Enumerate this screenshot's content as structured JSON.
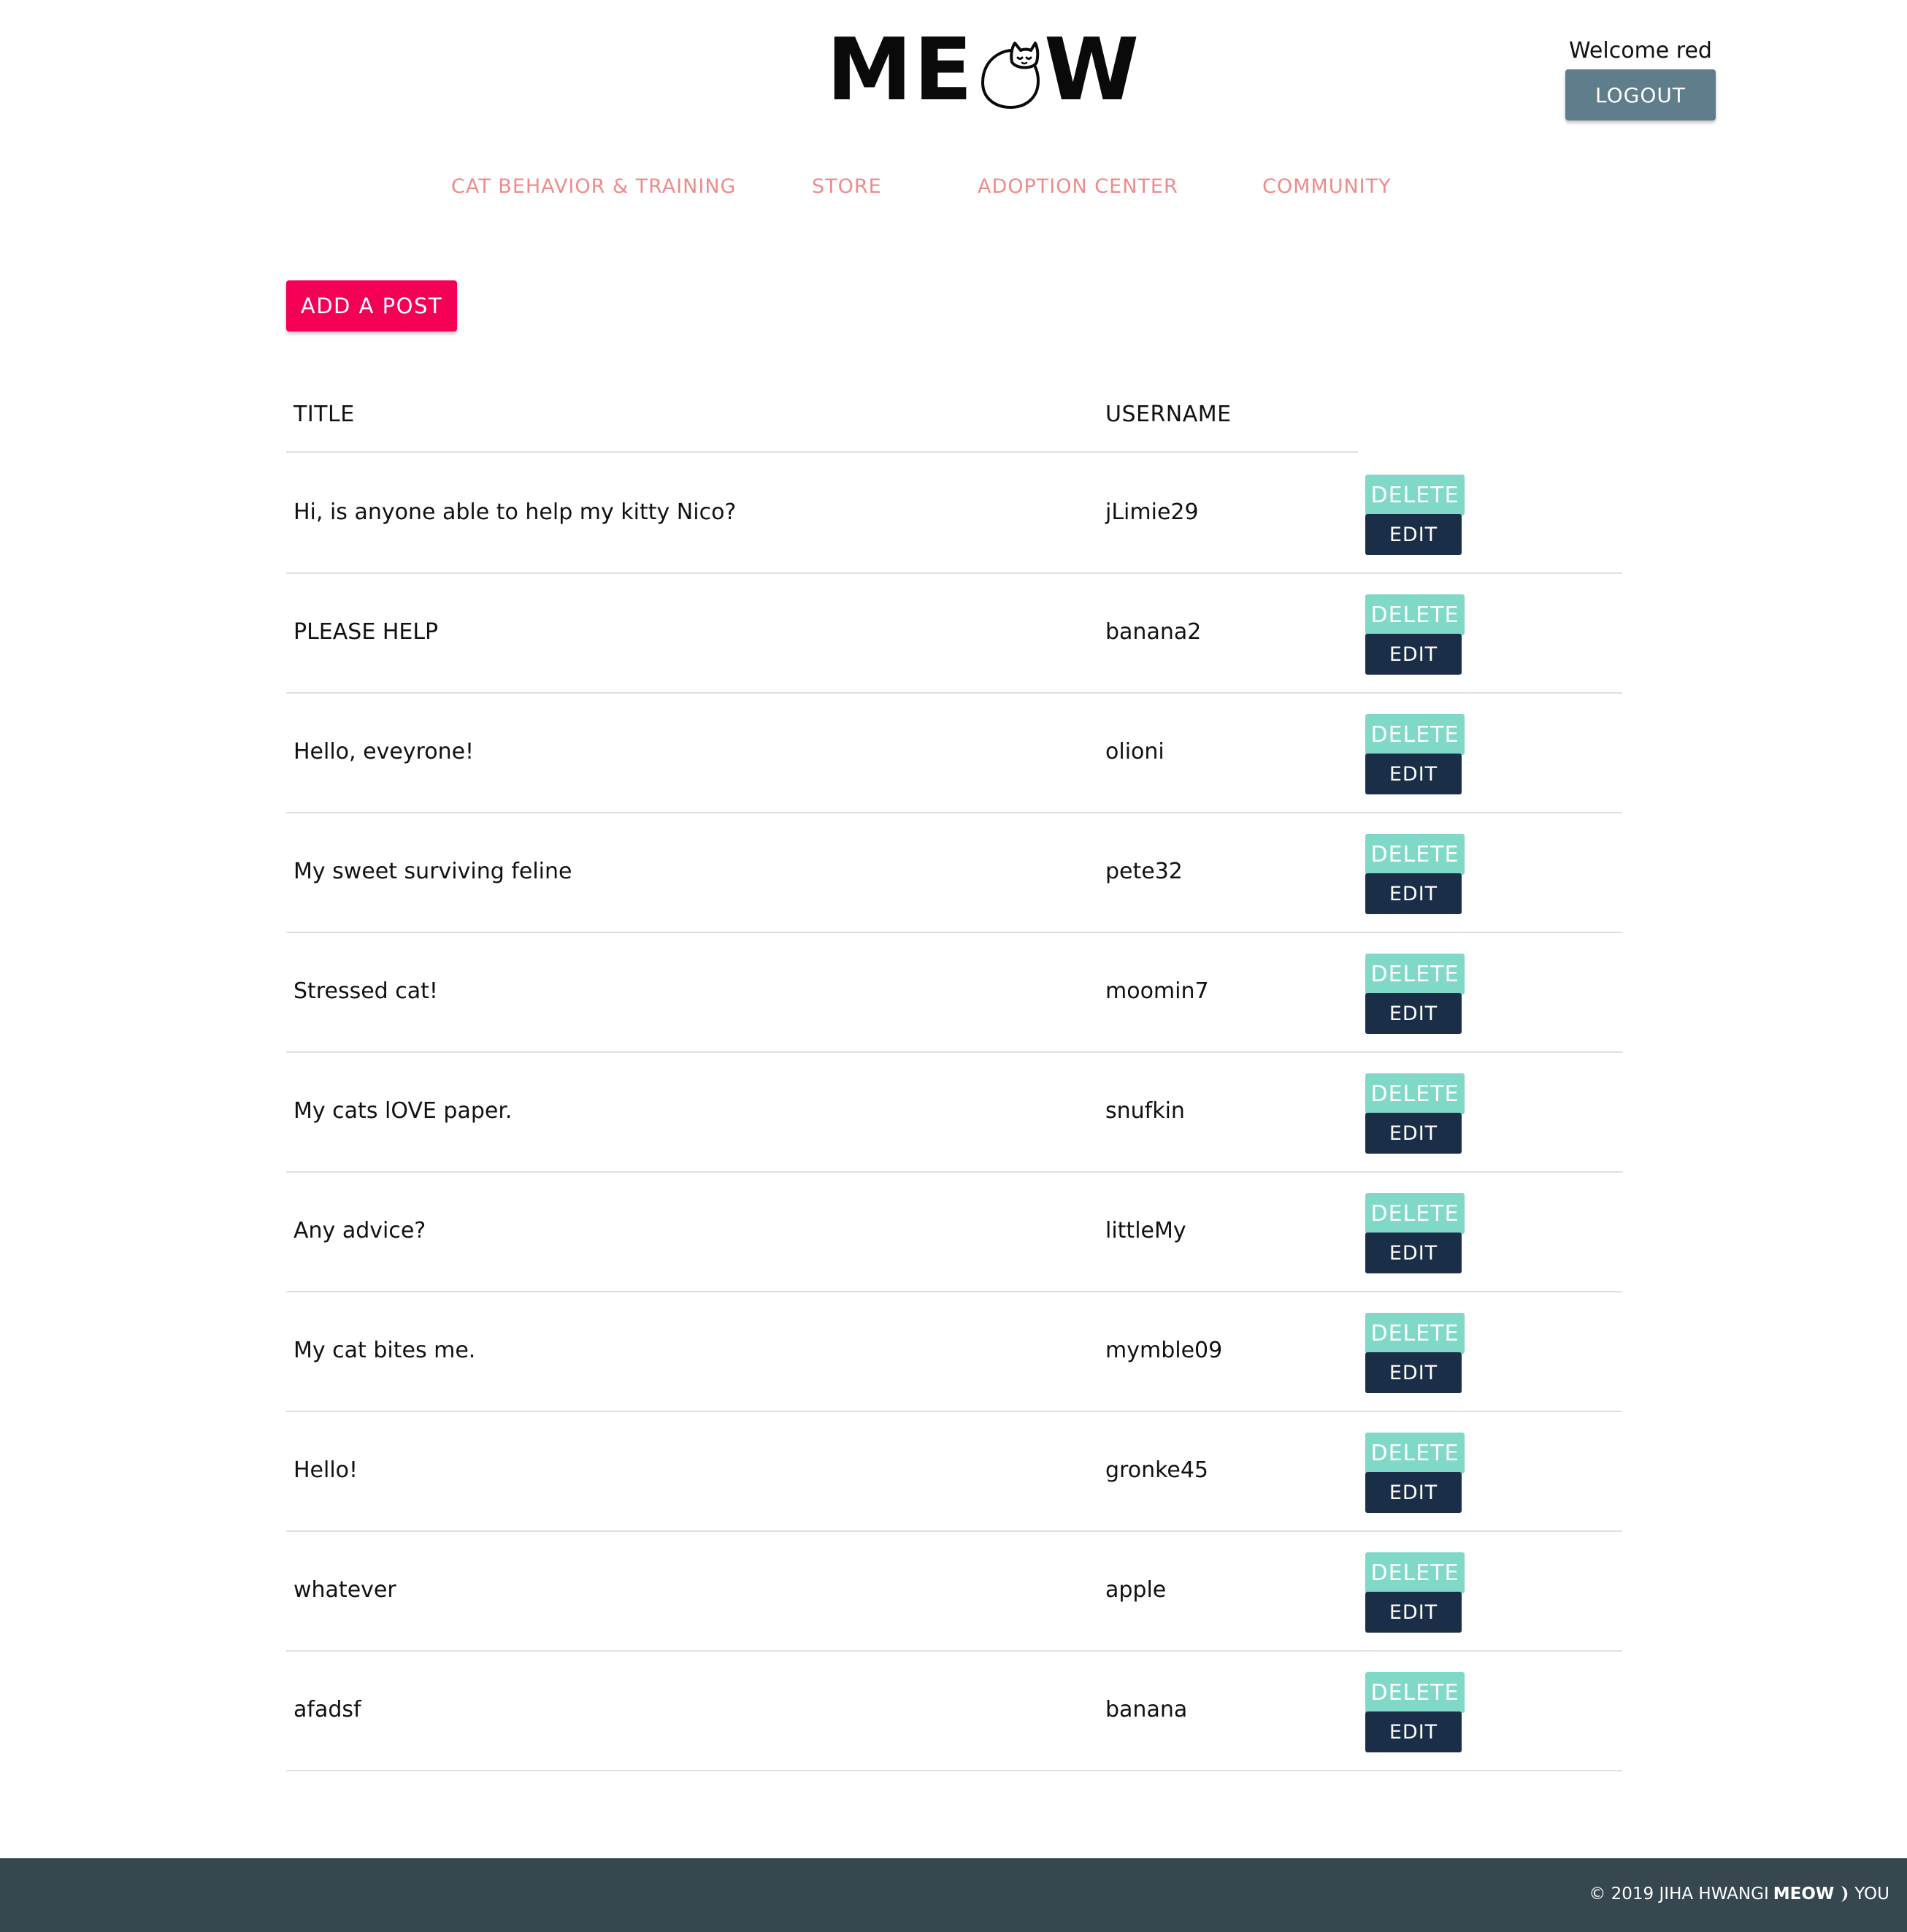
{
  "header": {
    "logo_left": "ME",
    "logo_right": "W",
    "welcome_text": "Welcome red",
    "logout_label": "LOGOUT"
  },
  "nav": {
    "items": [
      {
        "label": "CAT BEHAVIOR & TRAINING"
      },
      {
        "label": "STORE"
      },
      {
        "label": "ADOPTION CENTER"
      },
      {
        "label": "COMMUNITY"
      }
    ]
  },
  "actions": {
    "add_post_label": "ADD A POST"
  },
  "table": {
    "headers": {
      "title": "TITLE",
      "username": "USERNAME"
    },
    "delete_label": "DELETE",
    "edit_label": "EDIT",
    "rows": [
      {
        "title": "Hi, is anyone able to help my kitty Nico?",
        "username": "jLimie29"
      },
      {
        "title": "PLEASE HELP",
        "username": "banana2"
      },
      {
        "title": "Hello, eveyrone!",
        "username": "olioni"
      },
      {
        "title": "My sweet surviving feline",
        "username": "pete32"
      },
      {
        "title": "Stressed cat!",
        "username": "moomin7"
      },
      {
        "title": "My cats lOVE paper.",
        "username": "snufkin"
      },
      {
        "title": "Any advice?",
        "username": "littleMy"
      },
      {
        "title": "My cat bites me.",
        "username": "mymble09"
      },
      {
        "title": "Hello!",
        "username": "gronke45"
      },
      {
        "title": "whatever",
        "username": "apple"
      },
      {
        "title": "afadsf",
        "username": "banana"
      }
    ]
  },
  "footer": {
    "copyright": "© 2019 JIHA HWANGI",
    "brand": "MEOW",
    "suffix": "YOU"
  },
  "colors": {
    "nav_link": "#f08a8a",
    "add_post": "#f50057",
    "logout": "#607d8b",
    "delete": "#80d8c6",
    "edit": "#1b2e47",
    "footer": "#37474f"
  },
  "icons": [
    "cat-logo-icon",
    "moon-icon"
  ]
}
